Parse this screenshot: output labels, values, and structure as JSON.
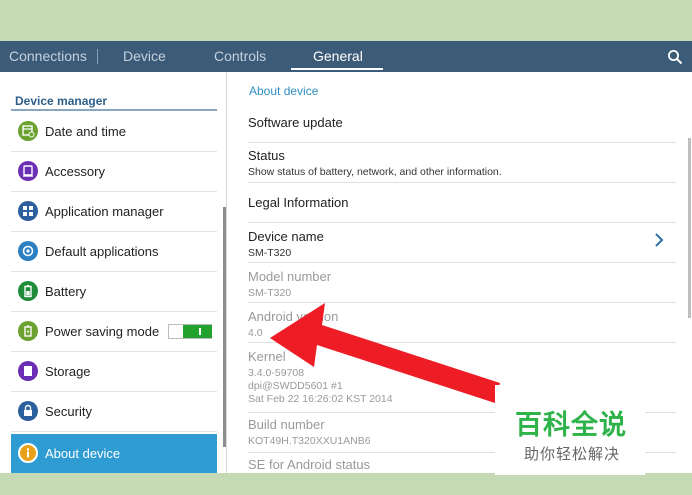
{
  "tabs": [
    {
      "label": "Connections",
      "active": false
    },
    {
      "label": "Device",
      "active": false
    },
    {
      "label": "Controls",
      "active": false
    },
    {
      "label": "General",
      "active": true
    }
  ],
  "search_icon": "search-icon",
  "sidebar": {
    "header": "Device manager",
    "items": [
      {
        "label": "Date and time",
        "icon": "calendar-clock-icon",
        "color": "#6aa12f"
      },
      {
        "label": "Accessory",
        "icon": "accessory-icon",
        "color": "#6b2fb3"
      },
      {
        "label": "Application manager",
        "icon": "grid-icon",
        "color": "#2c5f9e"
      },
      {
        "label": "Default applications",
        "icon": "default-apps-icon",
        "color": "#2c7fc0"
      },
      {
        "label": "Battery",
        "icon": "battery-icon",
        "color": "#1f8c3a"
      },
      {
        "label": "Power saving mode",
        "icon": "power-saving-icon",
        "color": "#6aa12f",
        "toggle": true
      },
      {
        "label": "Storage",
        "icon": "storage-icon",
        "color": "#6b2fb3"
      },
      {
        "label": "Security",
        "icon": "lock-icon",
        "color": "#2c5f9e"
      },
      {
        "label": "About device",
        "icon": "info-icon",
        "color": "#e8a21a",
        "selected": true
      }
    ]
  },
  "content": {
    "header": "About device",
    "rows": [
      {
        "title": "Software update"
      },
      {
        "title": "Status",
        "sub": "Show status of battery, network, and other information."
      },
      {
        "title": "Legal Information"
      },
      {
        "title": "Device name",
        "sub": "SM-T320",
        "chevron": true
      },
      {
        "title": "Model number",
        "sub": "SM-T320",
        "dim": true
      },
      {
        "title": "Android version",
        "sub": "4.0",
        "dim": true
      },
      {
        "title": "Kernel",
        "sub_lines": [
          "3.4.0-59708",
          "dpi@SWDD5601 #1",
          "Sat Feb 22 16:26:02 KST 2014"
        ],
        "dim": true
      },
      {
        "title": "Build number",
        "sub": "KOT49H.T320XXU1ANB6",
        "dim": true
      },
      {
        "title": "SE for Android status",
        "dim": true
      }
    ]
  },
  "watermark": {
    "main": "百科全说",
    "sub": "助你轻松解决"
  },
  "colors": {
    "tabbar": "#3c5b78",
    "accent": "#2f9bd3",
    "arrow": "#ee1c24",
    "brand": "#2db34a"
  }
}
